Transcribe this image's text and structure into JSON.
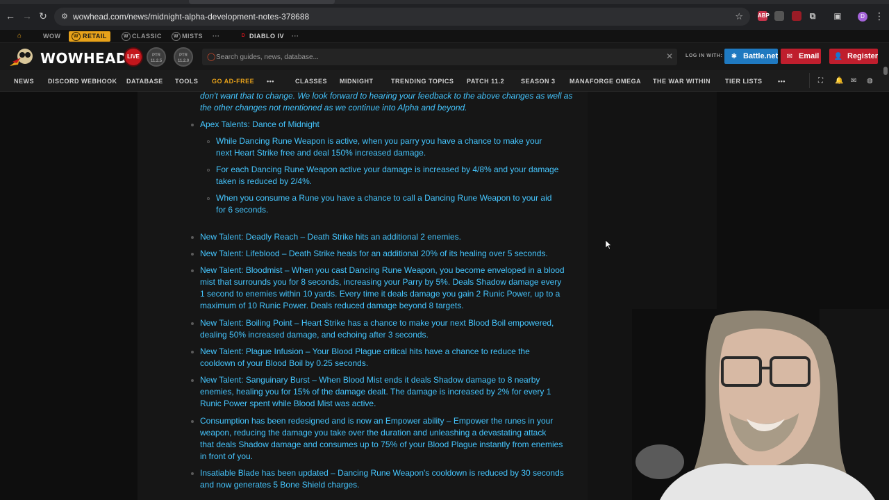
{
  "browser": {
    "url": "wowhead.com/news/midnight-alpha-development-notes-378688",
    "extensions": [
      "ABP",
      "ext-2",
      "ext-3",
      "puzzle-icon",
      "sidepanel-icon"
    ],
    "profile_initial": "D"
  },
  "game_switcher": {
    "items": [
      {
        "label": "WOW",
        "active": false
      },
      {
        "label": "RETAIL",
        "active": true
      },
      {
        "label": "CLASSIC",
        "active": false
      },
      {
        "label": "MISTS",
        "active": false
      },
      {
        "label": "···",
        "active": false
      },
      {
        "label": "DIABLO IV",
        "active": false
      },
      {
        "label": "···",
        "active": false
      }
    ]
  },
  "header": {
    "logo_text": "WOWHEAD",
    "live_badge": "LIVE",
    "ptr_badges": [
      "PTR 11.2.5",
      "PTR 11.2.0"
    ],
    "search_placeholder": "Search guides, news, database...",
    "login_label": "LOG IN WITH:",
    "battlenet_label": "Battle.net",
    "email_label": "Email",
    "register_label": "Register"
  },
  "nav": {
    "items": [
      "NEWS",
      "DISCORD WEBHOOK",
      "DATABASE",
      "TOOLS",
      "GO AD-FREE",
      "•••",
      "CLASSES",
      "MIDNIGHT",
      "TRENDING TOPICS",
      "PATCH 11.2",
      "SEASON 3",
      "MANAFORGE OMEGA",
      "THE WAR WITHIN",
      "TIER LISTS",
      "•••"
    ]
  },
  "article": {
    "intro_lines": [
      "don't want that to change. We look forward to hearing your feedback to the above changes as well as",
      "the other changes not mentioned as we continue into Alpha and beyond."
    ],
    "apex_heading": "Apex Talents: Dance of Midnight",
    "apex_items": [
      [
        "While Dancing Rune Weapon is active, when you parry you have a chance to make your",
        "next Heart Strike free and deal 150% increased damage."
      ],
      [
        "For each Dancing Rune Weapon active your damage is increased by 4/8% and your damage",
        "taken is reduced by 2/4%."
      ],
      [
        "When you consume a Rune you have a chance to call a Dancing Rune Weapon to your aid",
        "for 6 seconds."
      ]
    ],
    "items": [
      [
        "New Talent: Deadly Reach – Death Strike hits an additional 2 enemies."
      ],
      [
        "New Talent: Lifeblood – Death Strike heals for an additional 20% of its healing over 5 seconds."
      ],
      [
        "New Talent: Bloodmist – When you cast Dancing Rune Weapon, you become enveloped in a blood",
        "mist that surrounds you for 8 seconds, increasing your Parry by 5%. Deals Shadow damage every",
        "1 second to enemies within 10 yards. Every time it deals damage you gain 2 Runic Power, up to a",
        "maximum of 10 Runic Power. Deals reduced damage beyond 8 targets."
      ],
      [
        "New Talent: Boiling Point – Heart Strike has a chance to make your next Blood Boil empowered,",
        "dealing 50% increased damage, and echoing after 3 seconds."
      ],
      [
        "New Talent: Plague Infusion – Your Blood Plague critical hits have a chance to reduce the",
        "cooldown of your Blood Boil by 0.25 seconds."
      ],
      [
        "New Talent: Sanguinary Burst – When Blood Mist ends it deals Shadow damage to 8 nearby",
        "enemies, healing you for 15% of the damage dealt. The damage is increased by 2% for every 1",
        "Runic Power spent while Blood Mist was active."
      ],
      [
        "Consumption has been redesigned and is now an Empower ability – Empower the runes in your",
        "weapon, reducing the damage you take over the duration and unleashing a devastating attack",
        "that deals Shadow damage and consumes up to 75% of your Blood Plague instantly from enemies",
        "in front of you."
      ],
      [
        "Insatiable Blade has been updated – Dancing Rune Weapon's cooldown is reduced by 30 seconds",
        "and now generates 5 Bone Shield charges."
      ]
    ]
  },
  "colors": {
    "link": "#45c6ff",
    "accent": "#e8a21a",
    "battlenet": "#1f79c0",
    "red": "#bf1e2d"
  }
}
